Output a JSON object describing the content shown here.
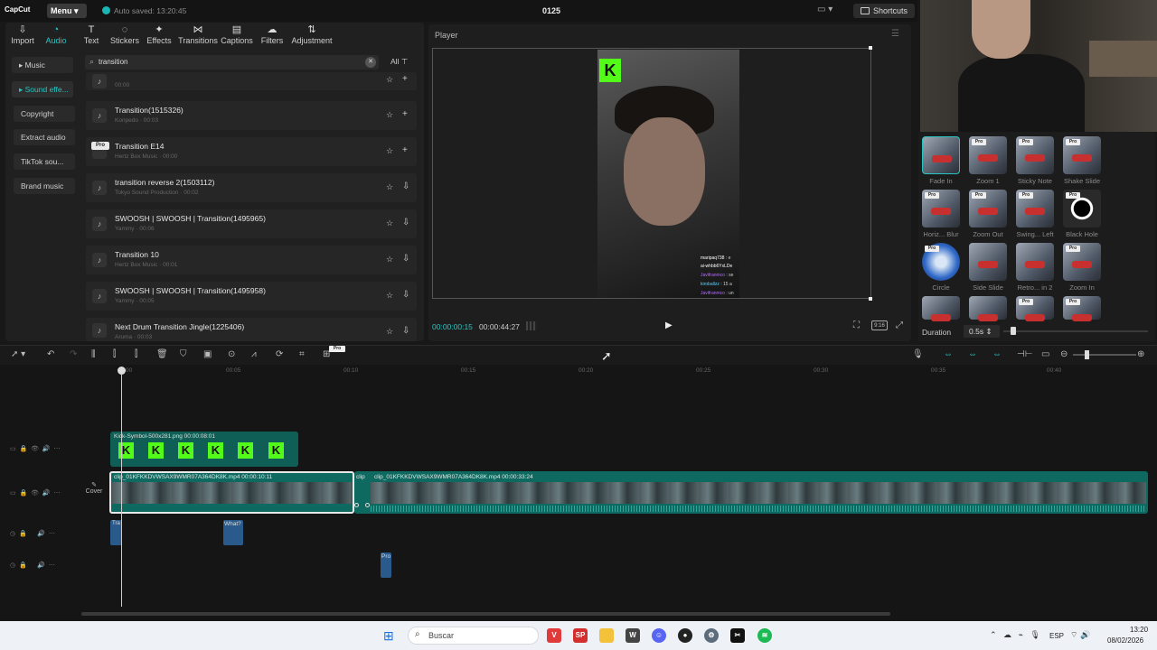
{
  "app": {
    "logo": "CapCut",
    "menu_label": "Menu",
    "autosave": "Auto saved: 13:20:45",
    "project_title": "0125",
    "shortcuts_label": "Shortcuts"
  },
  "tools": [
    {
      "label": "Import",
      "icon": "import-icon"
    },
    {
      "label": "Audio",
      "icon": "audio-icon",
      "active": true
    },
    {
      "label": "Text",
      "icon": "text-icon"
    },
    {
      "label": "Stickers",
      "icon": "sticker-icon"
    },
    {
      "label": "Effects",
      "icon": "effects-icon"
    },
    {
      "label": "Transitions",
      "icon": "transitions-icon"
    },
    {
      "label": "Captions",
      "icon": "captions-icon"
    },
    {
      "label": "Filters",
      "icon": "filters-icon"
    },
    {
      "label": "Adjustment",
      "icon": "adjustment-icon"
    }
  ],
  "categories": [
    {
      "label": "Music"
    },
    {
      "label": "Sound effe..."
    },
    {
      "label": "Copyright"
    },
    {
      "label": "Extract audio"
    },
    {
      "label": "TikTok sou..."
    },
    {
      "label": "Brand music"
    }
  ],
  "search": {
    "value": "transition",
    "filter_label": "All"
  },
  "sound_list": [
    {
      "title": "",
      "subtitle": "00:00",
      "pro": false
    },
    {
      "title": "Transition(1515326)",
      "subtitle": "Konpedo · 00:03",
      "pro": false
    },
    {
      "title": "Transition E14",
      "subtitle": "Hertz Box Music · 00:00",
      "pro": true
    },
    {
      "title": "transition reverse 2(1503112)",
      "subtitle": "Tokyo Sound Production · 00:02",
      "pro": false
    },
    {
      "title": "SWOOSH | SWOOSH | Transition(1495965)",
      "subtitle": "Yammy · 00:06",
      "pro": false
    },
    {
      "title": "Transition 10",
      "subtitle": "Hertz Box Music · 00:01",
      "pro": false
    },
    {
      "title": "SWOOSH | SWOOSH | Transition(1495958)",
      "subtitle": "Yammy · 00:05",
      "pro": false
    },
    {
      "title": "Next Drum Transition Jingle(1225406)",
      "subtitle": "Aruma · 00:03",
      "pro": false
    }
  ],
  "player": {
    "label": "Player",
    "current_time": "00:00:00:15",
    "total_time": "00:00:44:27",
    "ratio_label": "9:16",
    "overlay_logo": "K",
    "chat": [
      {
        "user": "maripaq738",
        "msg": "e",
        "color": "#ffffff"
      },
      {
        "user": "ai-whbb6YxLDe",
        "msg": "",
        "color": "#ffffff"
      },
      {
        "user": "Javifranmco",
        "msg": "se",
        "color": "#b36bff"
      },
      {
        "user": "kiroballzz",
        "msg": "15 a",
        "color": "#5ad3ff"
      },
      {
        "user": "Javifranmco",
        "msg": "un",
        "color": "#b36bff"
      }
    ]
  },
  "transitions_panel": {
    "items": [
      {
        "label": "Fade In",
        "pro": false
      },
      {
        "label": "Zoom 1",
        "pro": true
      },
      {
        "label": "Sticky Note",
        "pro": true
      },
      {
        "label": "Shake Slide",
        "pro": true
      },
      {
        "label": "Horiz... Blur",
        "pro": true
      },
      {
        "label": "Zoom Out",
        "pro": true
      },
      {
        "label": "Swing... Left",
        "pro": true
      },
      {
        "label": "Black Hole",
        "pro": true
      },
      {
        "label": "Circle",
        "pro": true
      },
      {
        "label": "Side Slide",
        "pro": false
      },
      {
        "label": "Retro... in 2",
        "pro": false
      },
      {
        "label": "Zoom In",
        "pro": true
      },
      {
        "label": "",
        "pro": false
      },
      {
        "label": "",
        "pro": false
      },
      {
        "label": "",
        "pro": true
      },
      {
        "label": "",
        "pro": true
      }
    ],
    "duration_label": "Duration",
    "duration_value": "0.5s"
  },
  "timeline": {
    "ticks": [
      "00:00",
      "00:05",
      "00:10",
      "00:15",
      "00:20",
      "00:25",
      "00:30",
      "00:35",
      "00:40"
    ],
    "cover_label": "Cover",
    "clips": {
      "kick": "Kick-Symbol-500x281.png   00:00:08:01",
      "clip1": "clip_01KFKKDVWSAX9WMR07A364DK8K.mp4   00:00:10:11",
      "clip2_prefix": "clip",
      "clip2": "clip_01KFKKDVWSAX9WMR07A364DK8K.mp4   00:00:33:24"
    },
    "audio": {
      "tr": "Tra",
      "what": "What?",
      "pro": "Pro"
    }
  },
  "taskbar": {
    "search_placeholder": "Buscar",
    "lang": "ESP",
    "time": "13:20",
    "date": "08/02/2026"
  }
}
